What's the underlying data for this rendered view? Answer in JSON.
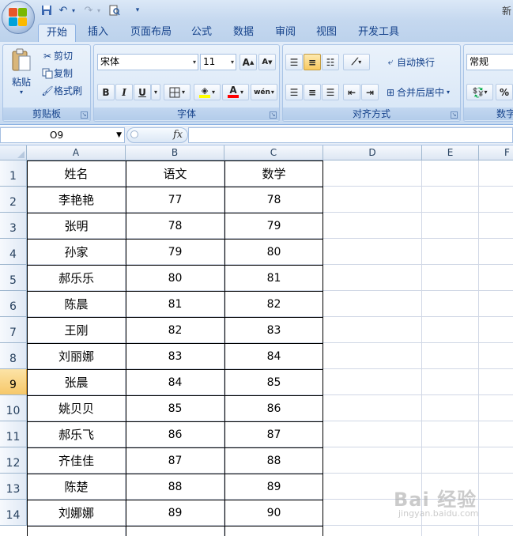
{
  "window": {
    "title_partial": "新"
  },
  "quick_access": {
    "save_icon": "save-icon",
    "undo_icon": "undo-icon",
    "redo_icon": "redo-icon",
    "preview_icon": "print-preview-icon",
    "customize": "▾"
  },
  "tabs": [
    "开始",
    "插入",
    "页面布局",
    "公式",
    "数据",
    "审阅",
    "视图",
    "开发工具"
  ],
  "ribbon": {
    "clipboard": {
      "paste": "粘贴",
      "cut": "剪切",
      "copy": "复制",
      "format_painter": "格式刷",
      "label": "剪贴板"
    },
    "font": {
      "name": "宋体",
      "size": "11",
      "grow": "A",
      "shrink": "A",
      "bold": "B",
      "italic": "I",
      "underline": "U",
      "label": "字体",
      "fill_color": "#ffff00",
      "font_color": "#ff0000"
    },
    "alignment": {
      "wrap": "自动换行",
      "merge": "合并后居中",
      "label": "对齐方式"
    },
    "number": {
      "format": "常规",
      "percent": "%",
      "label": "数字"
    }
  },
  "formula_bar": {
    "name_box": "O9",
    "fx": "fx",
    "formula": ""
  },
  "sheet": {
    "columns": [
      "A",
      "B",
      "C",
      "D",
      "E",
      "F"
    ],
    "rows": [
      "1",
      "2",
      "3",
      "4",
      "5",
      "6",
      "7",
      "8",
      "9",
      "10",
      "11",
      "12",
      "13",
      "14"
    ],
    "selected_row": "9",
    "header": [
      "姓名",
      "语文",
      "数学"
    ],
    "data": [
      [
        "李艳艳",
        "77",
        "78"
      ],
      [
        "张明",
        "78",
        "79"
      ],
      [
        "孙家",
        "79",
        "80"
      ],
      [
        "郝乐乐",
        "80",
        "81"
      ],
      [
        "陈晨",
        "81",
        "82"
      ],
      [
        "王刚",
        "82",
        "83"
      ],
      [
        "刘丽娜",
        "83",
        "84"
      ],
      [
        "张晨",
        "84",
        "85"
      ],
      [
        "姚贝贝",
        "85",
        "86"
      ],
      [
        "郝乐飞",
        "86",
        "87"
      ],
      [
        "齐佳佳",
        "87",
        "88"
      ],
      [
        "陈楚",
        "88",
        "89"
      ],
      [
        "刘娜娜",
        "89",
        "90"
      ]
    ]
  },
  "watermark": {
    "main": "Bai 经验",
    "sub": "jingyan.baidu.com"
  }
}
